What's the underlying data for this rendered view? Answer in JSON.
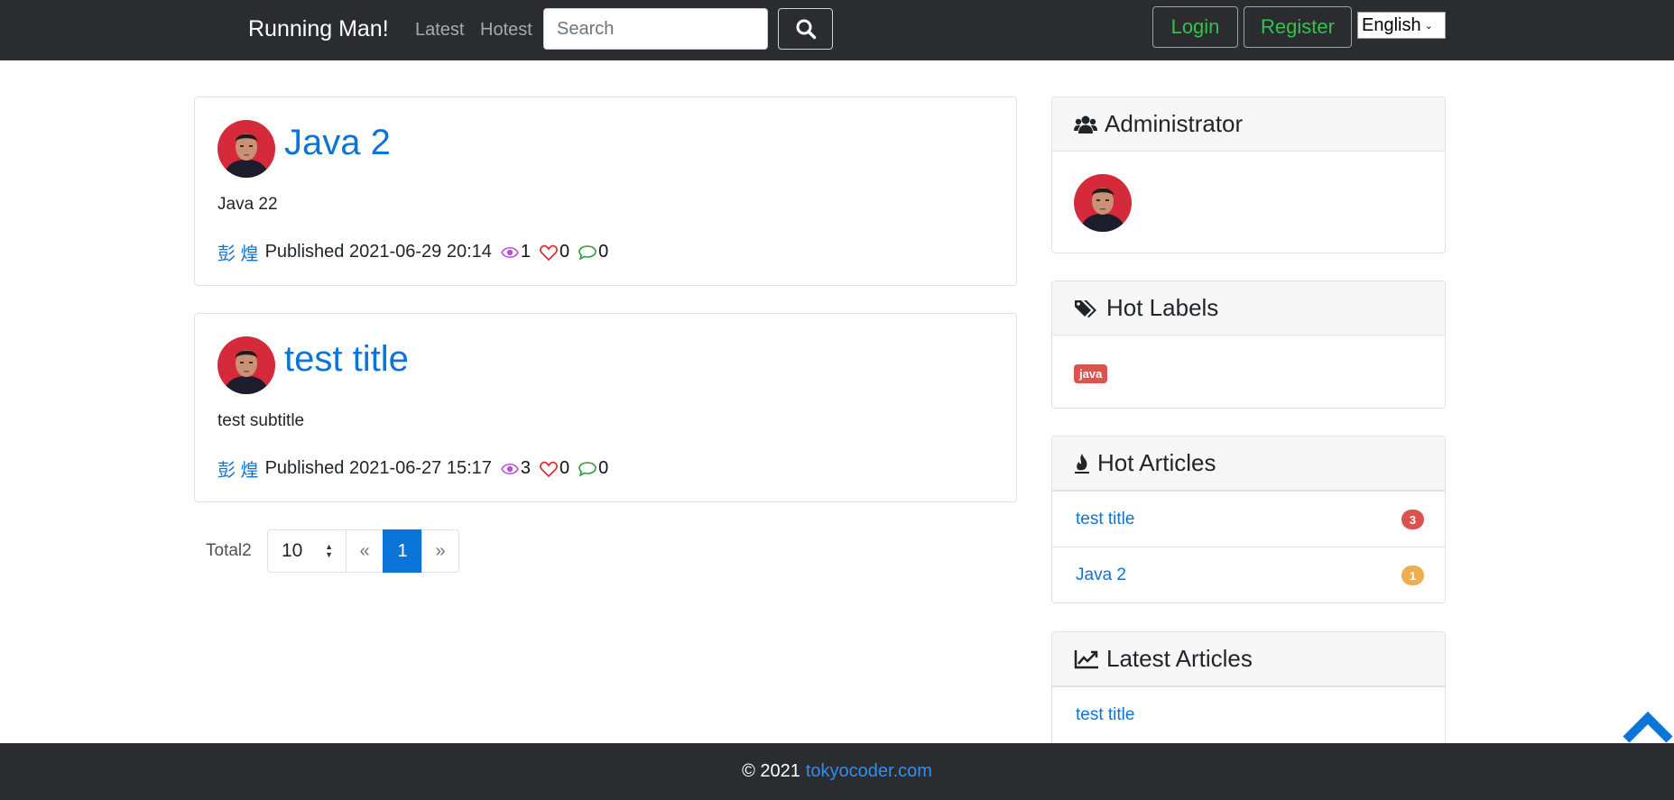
{
  "navbar": {
    "brand": "Running Man!",
    "links": [
      "Latest",
      "Hotest"
    ],
    "search_placeholder": "Search",
    "login_label": "Login",
    "register_label": "Register",
    "language": "English"
  },
  "posts": [
    {
      "title": "Java 2",
      "subtitle": "Java 22",
      "author": "彭 煌",
      "published": "Published 2021-06-29 20:14",
      "views": "1",
      "likes": "0",
      "comments": "0"
    },
    {
      "title": "test title",
      "subtitle": "test subtitle",
      "author": "彭 煌",
      "published": "Published 2021-06-27 15:17",
      "views": "3",
      "likes": "0",
      "comments": "0"
    }
  ],
  "pagination": {
    "total": "Total2",
    "page_size": "10",
    "prev": "«",
    "current": "1",
    "next": "»"
  },
  "sidebar": {
    "admin_title": "Administrator",
    "labels_title": "Hot Labels",
    "labels": [
      "java"
    ],
    "hot_title": "Hot Articles",
    "hot_articles": [
      {
        "title": "test title",
        "count": "3",
        "color": "#d9534f"
      },
      {
        "title": "Java 2",
        "count": "1",
        "color": "#f0ad4e"
      }
    ],
    "latest_title": "Latest Articles",
    "latest_articles": [
      "test title"
    ]
  },
  "footer": {
    "copyright": "© 2021",
    "link": "tokyocoder.com"
  },
  "colors": {
    "navbar_bg": "#2b2c2f",
    "link_blue": "#0b74d9",
    "outline_green": "#34c24a",
    "tag_red": "#d9534f"
  }
}
